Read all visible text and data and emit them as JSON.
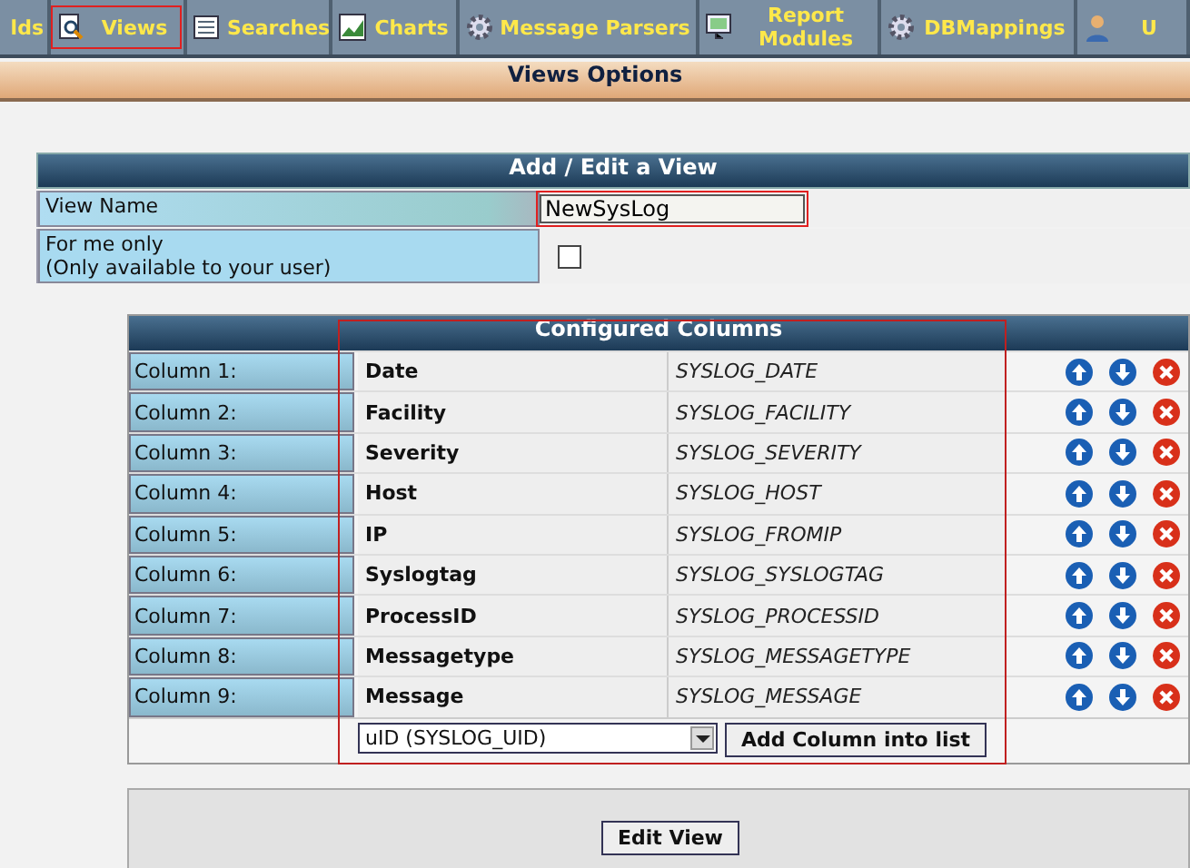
{
  "nav_tabs": [
    {
      "label": "lds",
      "highlighted": false
    },
    {
      "label": "Views",
      "highlighted": true
    },
    {
      "label": "Searches",
      "highlighted": false
    },
    {
      "label": "Charts",
      "highlighted": false
    },
    {
      "label": "Message Parsers",
      "highlighted": false
    },
    {
      "label": "Report Modules",
      "highlighted": false
    },
    {
      "label": "DBMappings",
      "highlighted": false
    },
    {
      "label": "U",
      "highlighted": false
    }
  ],
  "section_title": "Views Options",
  "view_form": {
    "title": "Add / Edit a View",
    "rows": [
      {
        "kind": "text",
        "label": "View Name",
        "value": "NewSysLog",
        "highlighted": true
      },
      {
        "kind": "checkbox",
        "label": "For me only",
        "sublabel": "(Only available to your user)",
        "checked": false
      }
    ]
  },
  "columns_table": {
    "title": "Configured Columns",
    "highlighted": true,
    "rows": [
      {
        "label": "Column 1:",
        "name": "Date",
        "field": "SYSLOG_DATE"
      },
      {
        "label": "Column 2:",
        "name": "Facility",
        "field": "SYSLOG_FACILITY"
      },
      {
        "label": "Column 3:",
        "name": "Severity",
        "field": "SYSLOG_SEVERITY"
      },
      {
        "label": "Column 4:",
        "name": "Host",
        "field": "SYSLOG_HOST"
      },
      {
        "label": "Column 5:",
        "name": "IP",
        "field": "SYSLOG_FROMIP"
      },
      {
        "label": "Column 6:",
        "name": "Syslogtag",
        "field": "SYSLOG_SYSLOGTAG"
      },
      {
        "label": "Column 7:",
        "name": "ProcessID",
        "field": "SYSLOG_PROCESSID"
      },
      {
        "label": "Column 8:",
        "name": "Messagetype",
        "field": "SYSLOG_MESSAGETYPE"
      },
      {
        "label": "Column 9:",
        "name": "Message",
        "field": "SYSLOG_MESSAGE"
      }
    ],
    "add_select": "uID (SYSLOG_UID)",
    "add_button": "Add Column into list"
  },
  "submit_button": "Edit View"
}
